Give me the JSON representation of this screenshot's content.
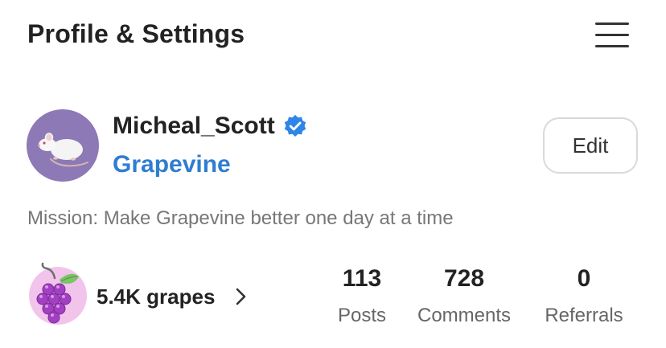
{
  "header": {
    "title": "Profile & Settings",
    "menu_icon": "hamburger-menu-icon"
  },
  "profile": {
    "avatar_icon": "white-rat-avatar",
    "avatar_bg": "#8c79b6",
    "username": "Micheal_Scott",
    "verified_icon": "verified-badge-icon",
    "verified_color": "#2f86e6",
    "community": "Grapevine",
    "community_color": "#2f7dd1",
    "edit_label": "Edit"
  },
  "mission": "Mission: Make Grapevine better one day at a time",
  "grapes": {
    "icon": "grapes-icon",
    "icon_bg": "#f2c4ec",
    "count_label": "5.4K grapes",
    "chevron_icon": "chevron-right-icon"
  },
  "stats": [
    {
      "value": "113",
      "label": "Posts"
    },
    {
      "value": "728",
      "label": "Comments"
    },
    {
      "value": "0",
      "label": "Referrals"
    }
  ]
}
